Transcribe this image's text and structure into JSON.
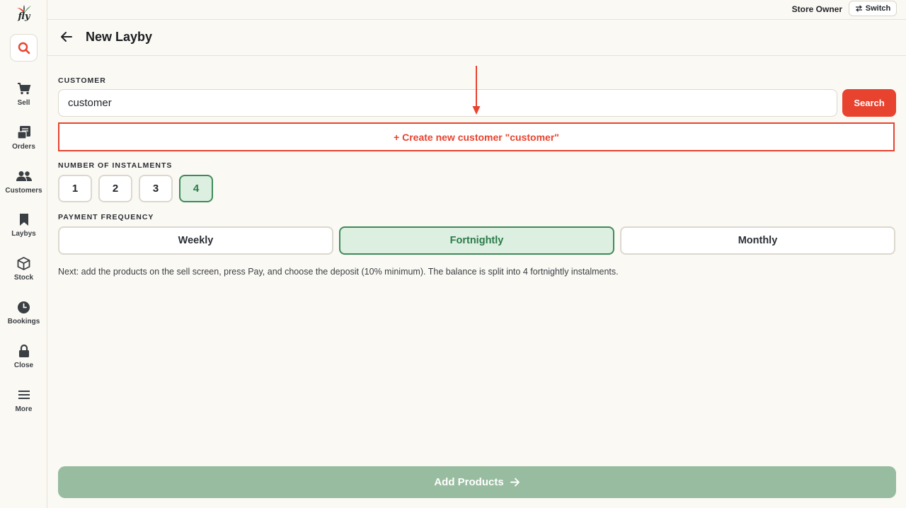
{
  "brand": {
    "logo_text": "fly"
  },
  "sidebar": {
    "items": [
      {
        "label": "Sell",
        "icon": "cart-icon"
      },
      {
        "label": "Orders",
        "icon": "receipt-icon"
      },
      {
        "label": "Customers",
        "icon": "users-icon"
      },
      {
        "label": "Laybys",
        "icon": "bookmark-icon"
      },
      {
        "label": "Stock",
        "icon": "box-icon"
      },
      {
        "label": "Bookings",
        "icon": "clock-icon"
      },
      {
        "label": "Close",
        "icon": "lock-icon"
      },
      {
        "label": "More",
        "icon": "menu-icon"
      }
    ]
  },
  "topbar": {
    "user": "Store Owner",
    "switch_label": "Switch"
  },
  "header": {
    "title": "New Layby"
  },
  "customer": {
    "label": "CUSTOMER",
    "input_value": "customer",
    "search_label": "Search",
    "create_label": "+ Create new customer \"customer\""
  },
  "instalments": {
    "label": "NUMBER OF INSTALMENTS",
    "options": [
      "1",
      "2",
      "3",
      "4"
    ],
    "selected": "4"
  },
  "frequency": {
    "label": "PAYMENT FREQUENCY",
    "options": [
      "Weekly",
      "Fortnightly",
      "Monthly"
    ],
    "selected": "Fortnightly"
  },
  "hint": "Next: add the products on the sell screen, press Pay, and choose the deposit (10% minimum). The balance is split into 4 fortnightly instalments.",
  "footer": {
    "add_products_label": "Add Products"
  },
  "colors": {
    "accent_red": "#e8432f",
    "selected_green": "#2c7a49",
    "selected_bg": "#dcefe0",
    "primary_disabled": "#97bc9f"
  }
}
